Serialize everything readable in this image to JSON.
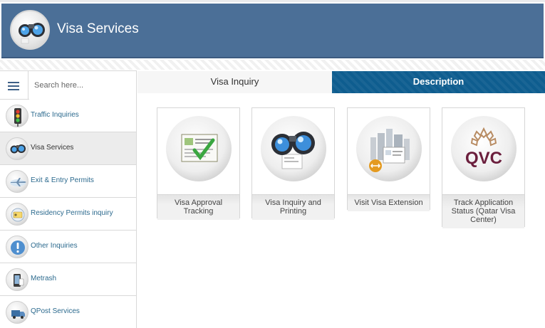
{
  "header": {
    "title": "Visa Services",
    "logo_icon": "binoculars-icon"
  },
  "sidebar": {
    "search_placeholder": "Search here...",
    "items": [
      {
        "label": "Traffic Inquiries",
        "icon": "traffic-light-icon",
        "active": false
      },
      {
        "label": "Visa Services",
        "icon": "binoculars-icon",
        "active": true
      },
      {
        "label": "Exit & Entry Permits",
        "icon": "airplane-icon",
        "active": false
      },
      {
        "label": "Residency Permits inquiry",
        "icon": "residency-card-icon",
        "active": false
      },
      {
        "label": "Other Inquiries",
        "icon": "exclamation-icon",
        "active": false
      },
      {
        "label": "Metrash",
        "icon": "phone-icon",
        "active": false
      },
      {
        "label": "QPost Services",
        "icon": "delivery-truck-icon",
        "active": false
      }
    ]
  },
  "tabs": {
    "inquiry": "Visa Inquiry",
    "description": "Description"
  },
  "cards": [
    {
      "label": "Visa Approval Tracking",
      "icon": "approval-document-icon"
    },
    {
      "label": "Visa Inquiry and Printing",
      "icon": "binoculars-icon"
    },
    {
      "label": "Visit Visa Extension",
      "icon": "city-extension-icon"
    },
    {
      "label": "Track Application Status (Qatar Visa Center)",
      "icon": "qvc-logo-icon",
      "logo_text": "QVC"
    }
  ],
  "colors": {
    "header": "#4b6f97",
    "active_tab": "#0e5d8f",
    "link": "#2c6a8e",
    "qvc": "#6b1f3d"
  }
}
